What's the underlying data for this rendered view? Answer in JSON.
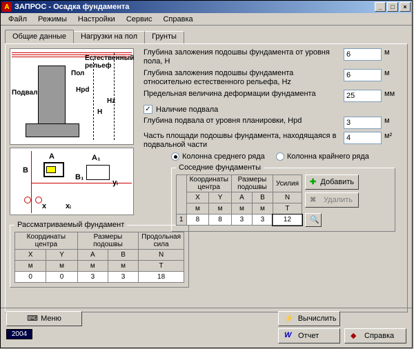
{
  "window": {
    "title": "ЗАПРОС - Осадка фундамента"
  },
  "menubar": {
    "file": "Файл",
    "modes": "Режимы",
    "settings": "Настройки",
    "service": "Сервис",
    "help": "Справка"
  },
  "tabs": {
    "t0": "Общие данные",
    "t1": "Нагрузки на пол",
    "t2": "Грунты"
  },
  "diagram": {
    "relief": "Естественный\nрельеф",
    "floor": "Пол",
    "basement": "Подвал",
    "Hpd": "Hpd",
    "Hz": "Hz",
    "H": "H",
    "A": "A",
    "A1": "A₁",
    "B": "B",
    "B1": "B₁",
    "x": "x",
    "xi": "xᵢ",
    "yi": "yᵢ"
  },
  "fields": {
    "f1_label": "Глубина заложения подошвы фундамента от уровня пола, H",
    "f1_val": "6",
    "f1_unit": "м",
    "f2_label": "Глубина заложения подошвы фундамента относительно естественного рельефа, Hz",
    "f2_val": "6",
    "f2_unit": "м",
    "f3_label": "Предельная величина деформации фундамента",
    "f3_val": "25",
    "f3_unit": "мм",
    "chk1_label": "Наличие подвала",
    "chk1_checked": "✓",
    "f4_label": "Глубина подвала от уровня планировки, Hpd",
    "f4_val": "3",
    "f4_unit": "м",
    "f5_label": "Часть площади подошвы фундамента, находящаяся в подвальной части",
    "f5_val": "4",
    "f5_unit": "м²"
  },
  "radios": {
    "r1": "Колонна среднего ряда",
    "r2": "Колонна крайнего ряда"
  },
  "own_fs": "Рассматриваемый фундамент",
  "own_tbl": {
    "h_coord": "Координаты центра",
    "h_size": "Размеры подошвы",
    "h_force": "Продольная сила",
    "X": "X",
    "Y": "Y",
    "A": "A",
    "B": "B",
    "N": "N",
    "u_m": "м",
    "u_T": "Т",
    "vX": "0",
    "vY": "0",
    "vA": "3",
    "vB": "3",
    "vN": "18"
  },
  "neigh_fs": "Соседние фундаменты",
  "neigh_tbl": {
    "h_coord": "Координаты центра",
    "h_size": "Размеры подошвы",
    "h_force": "Усилия",
    "X": "X",
    "Y": "Y",
    "A": "A",
    "B": "B",
    "N": "N",
    "u_m": "м",
    "u_T": "Т",
    "row": "1",
    "vX": "8",
    "vY": "8",
    "vA": "3",
    "vB": "3",
    "vN": "12"
  },
  "sidebtns": {
    "add": "Добавить",
    "del": "Удалить"
  },
  "bottom": {
    "menu": "Меню",
    "calc": "Вычислить",
    "report": "Отчет",
    "help": "Справка",
    "year": "2004"
  }
}
